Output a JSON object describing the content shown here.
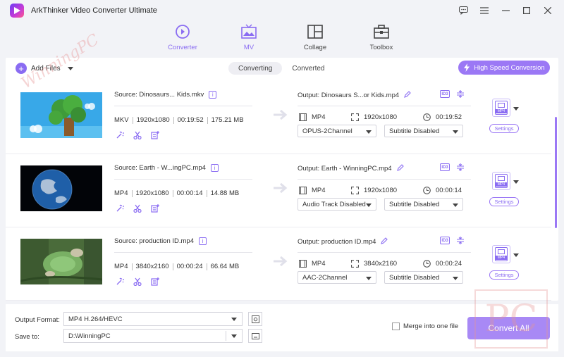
{
  "app": {
    "title": "ArkThinker Video Converter Ultimate"
  },
  "watermark": {
    "text": "WinningPC",
    "corner_text": "PC"
  },
  "nav": [
    {
      "label": "Converter",
      "icon": "converter-icon",
      "active": true
    },
    {
      "label": "MV",
      "icon": "mv-icon",
      "active": false
    },
    {
      "label": "Collage",
      "icon": "collage-icon",
      "active": false
    },
    {
      "label": "Toolbox",
      "icon": "toolbox-icon",
      "active": false
    }
  ],
  "toolbar": {
    "add_files": "Add Files",
    "tabs": [
      "Converting",
      "Converted"
    ],
    "high_speed": "High Speed Conversion"
  },
  "files": [
    {
      "source": "Source: Dinosaurs... Kids.mkv",
      "format": "MKV",
      "resolution": "1920x1080",
      "duration": "00:19:52",
      "size": "175.21 MB",
      "output": "Output: Dinosaurs S...or Kids.mp4",
      "out_format": "MP4",
      "out_resolution": "1920x1080",
      "out_duration": "00:19:52",
      "audio": "OPUS-2Channel",
      "subtitle": "Subtitle Disabled",
      "settings": "Settings",
      "fmt_badge": "MP4"
    },
    {
      "source": "Source: Earth - W...ingPC.mp4",
      "format": "MP4",
      "resolution": "1920x1080",
      "duration": "00:00:14",
      "size": "14.88 MB",
      "output": "Output: Earth - WinningPC.mp4",
      "out_format": "MP4",
      "out_resolution": "1920x1080",
      "out_duration": "00:00:14",
      "audio": "Audio Track Disabled",
      "subtitle": "Subtitle Disabled",
      "settings": "Settings",
      "fmt_badge": "MP4"
    },
    {
      "source": "Source: production ID.mp4",
      "format": "MP4",
      "resolution": "3840x2160",
      "duration": "00:00:24",
      "size": "66.64 MB",
      "output": "Output: production ID.mp4",
      "out_format": "MP4",
      "out_resolution": "3840x2160",
      "out_duration": "00:00:24",
      "audio": "AAC-2Channel",
      "subtitle": "Subtitle Disabled",
      "settings": "Settings",
      "fmt_badge": "MP4"
    }
  ],
  "bottom": {
    "output_format_label": "Output Format:",
    "output_format_value": "MP4 H.264/HEVC",
    "save_to_label": "Save to:",
    "save_to_value": "D:\\WinningPC",
    "merge_label": "Merge into one file",
    "convert_all": "Convert All"
  },
  "colors": {
    "accent": "#8a6cf2",
    "accent_light": "#9b78f5",
    "background": "#f2f3f7"
  }
}
